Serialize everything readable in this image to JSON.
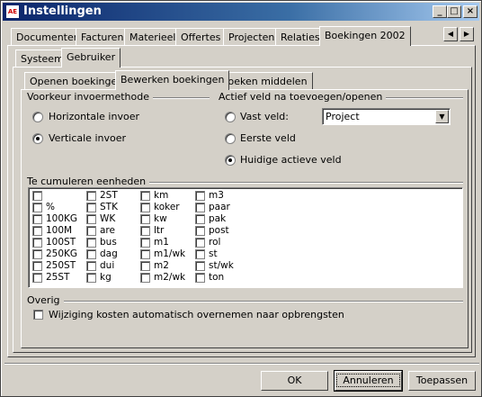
{
  "window": {
    "app_icon_text": "AE",
    "title": "Instellingen"
  },
  "main_tabs": [
    {
      "label": "Documenten"
    },
    {
      "label": "Facturen"
    },
    {
      "label": "Materieel"
    },
    {
      "label": "Offertes"
    },
    {
      "label": "Projecten"
    },
    {
      "label": "Relaties"
    },
    {
      "label": "Boekingen 2002"
    }
  ],
  "sub_tabs": [
    {
      "label": "Systeem"
    },
    {
      "label": "Gebruiker"
    }
  ],
  "inner_tabs": [
    {
      "label": "Openen boekingen"
    },
    {
      "label": "Bewerken boekingen"
    },
    {
      "label": "Zoeken middelen"
    }
  ],
  "input_method": {
    "heading": "Voorkeur invoermethode",
    "options": [
      {
        "label": "Horizontale invoer",
        "checked": false
      },
      {
        "label": "Verticale invoer",
        "checked": true
      }
    ]
  },
  "active_field": {
    "heading": "Actief veld na toevoegen/openen",
    "options": [
      {
        "label": "Vast veld:",
        "checked": false
      },
      {
        "label": "Eerste veld",
        "checked": false
      },
      {
        "label": "Huidige actieve veld",
        "checked": true
      }
    ],
    "fixed_field_value": "Project"
  },
  "units": {
    "heading": "Te cumuleren eenheden",
    "columns": [
      [
        "",
        "%",
        "100KG",
        "100M",
        "100ST",
        "250KG",
        "250ST",
        "25ST"
      ],
      [
        "2ST",
        "STK",
        "WK",
        "are",
        "bus",
        "dag",
        "dui",
        "kg"
      ],
      [
        "km",
        "koker",
        "kw",
        "ltr",
        "m1",
        "m1/wk",
        "m2",
        "m2/wk"
      ],
      [
        "m3",
        "paar",
        "pak",
        "post",
        "rol",
        "st",
        "st/wk",
        "ton"
      ]
    ]
  },
  "overig": {
    "heading": "Overig",
    "checkbox_label": "Wijziging kosten automatisch overnemen naar opbrengsten"
  },
  "buttons": {
    "ok": "OK",
    "cancel": "Annuleren",
    "apply": "Toepassen"
  }
}
